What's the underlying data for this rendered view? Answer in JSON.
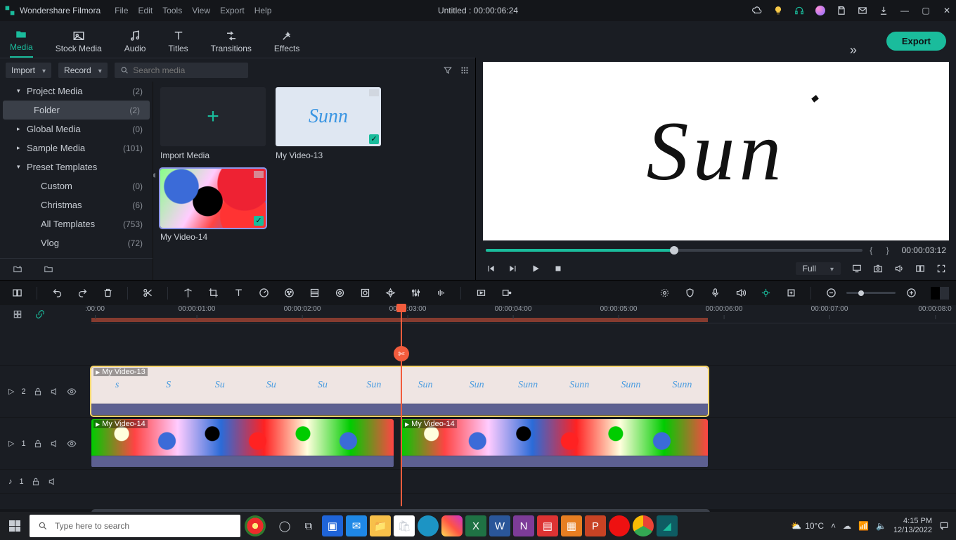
{
  "app": {
    "name": "Wondershare Filmora",
    "title": "Untitled : 00:00:06:24"
  },
  "menu": [
    "File",
    "Edit",
    "Tools",
    "View",
    "Export",
    "Help"
  ],
  "tabs": [
    {
      "key": "media",
      "label": "Media"
    },
    {
      "key": "stock",
      "label": "Stock Media"
    },
    {
      "key": "audio",
      "label": "Audio"
    },
    {
      "key": "titles",
      "label": "Titles"
    },
    {
      "key": "transitions",
      "label": "Transitions"
    },
    {
      "key": "effects",
      "label": "Effects"
    }
  ],
  "export_btn": "Export",
  "browser": {
    "import_dd": "Import",
    "record_dd": "Record",
    "search_placeholder": "Search media"
  },
  "tree": {
    "project": {
      "label": "Project Media",
      "count": "(2)"
    },
    "folder": {
      "label": "Folder",
      "count": "(2)"
    },
    "global": {
      "label": "Global Media",
      "count": "(0)"
    },
    "sample": {
      "label": "Sample Media",
      "count": "(101)"
    },
    "preset": {
      "label": "Preset Templates",
      "count": ""
    },
    "custom": {
      "label": "Custom",
      "count": "(0)"
    },
    "christmas": {
      "label": "Christmas",
      "count": "(6)"
    },
    "alltpl": {
      "label": "All Templates",
      "count": "(753)"
    },
    "vlog": {
      "label": "Vlog",
      "count": "(72)"
    }
  },
  "thumbs": {
    "import": "Import Media",
    "v13": "My Video-13",
    "v14": "My Video-14"
  },
  "preview": {
    "quality": "Full",
    "time": "00:00:03:12",
    "braces": "{     }"
  },
  "ruler": [
    ":00:00",
    "00:00:01:00",
    "00:00:02:00",
    "00:00:03:00",
    "00:00:04:00",
    "00:00:05:00",
    "00:00:06:00",
    "00:00:07:00",
    "00:00:08:0"
  ],
  "tracks": {
    "t2": "2",
    "t1": "1",
    "a1": "1",
    "clip13": "My Video-13",
    "clip14a": "My Video-14",
    "clip14b": "My Video-14"
  },
  "taskbar": {
    "search": "Type here to search",
    "weather": "10°C",
    "time": "4:15 PM",
    "date": "12/13/2022"
  }
}
